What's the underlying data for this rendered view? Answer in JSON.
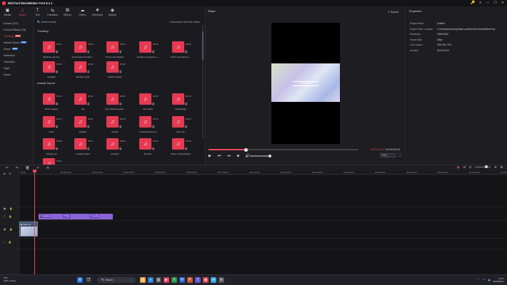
{
  "window": {
    "title": "MiniTool MovieMaker Free 8.1.1",
    "controls": [
      "🔑",
      "≡",
      "—",
      "☐",
      "✕"
    ]
  },
  "toolbar": [
    {
      "label": "Media",
      "icon": "▣"
    },
    {
      "label": "Audio",
      "icon": "♫"
    },
    {
      "label": "Text",
      "icon": "T"
    },
    {
      "label": "Transition",
      "icon": "⇆"
    },
    {
      "label": "Effects",
      "icon": "✪"
    },
    {
      "label": "Filters",
      "icon": "☁"
    },
    {
      "label": "Elements",
      "icon": "❖"
    },
    {
      "label": "Motion",
      "icon": "◉"
    }
  ],
  "sidebar": {
    "music": "▸ Music (101)",
    "sound": "▾ Sound Effects (78)",
    "items": [
      {
        "label": "Trending",
        "badge": "NEW"
      },
      {
        "label": "Animal Sound",
        "badge": "NEW"
      },
      {
        "label": "Game",
        "badge": "NEW"
      },
      {
        "label": "Ambience",
        "badge": ""
      },
      {
        "label": "Transition",
        "badge": ""
      },
      {
        "label": "Fight",
        "badge": ""
      },
      {
        "label": "Horror",
        "badge": ""
      }
    ]
  },
  "media": {
    "search": "🔍 Search audio",
    "download": "↓ Download YouTube Video",
    "sections": [
      {
        "title": "Trending",
        "tiles": [
          {
            "name": "Machine gun fire",
            "dur": "00:01"
          },
          {
            "name": "Cool impact trends A...",
            "dur": "00:05"
          },
          {
            "name": "Horror atmosphere",
            "dur": "00:06"
          },
          {
            "name": "Arcade retro game o...",
            "dur": "00:03"
          },
          {
            "name": "Clock countdown ti...",
            "dur": "00:05"
          },
          {
            "name": "Gunfight",
            "dur": "00:03"
          },
          {
            "name": "Monster howl",
            "dur": "00:03"
          },
          {
            "name": "Sinister Steam",
            "dur": "00:02"
          }
        ]
      },
      {
        "title": "Animal Sound",
        "tiles": [
          {
            "name": "Birds singing",
            "dur": "00:12"
          },
          {
            "name": "Cat",
            "dur": "00:01"
          },
          {
            "name": "Cat chattering and...",
            "dur": "00:05"
          },
          {
            "name": "Cat meow",
            "dur": "00:01"
          },
          {
            "name": "Chatty pigs",
            "dur": "00:10"
          },
          {
            "name": "Crow",
            "dur": "00:15"
          },
          {
            "name": "Dolphin",
            "dur": "00:01"
          },
          {
            "name": "Gerbils",
            "dur": "00:05"
          },
          {
            "name": "Growling bear hit",
            "dur": "00:01"
          },
          {
            "name": "Hen rise",
            "dur": "00:04"
          },
          {
            "name": "Hungry cat",
            "dur": "00:08"
          },
          {
            "name": "Leopard attack",
            "dur": "00:01"
          },
          {
            "name": "Penguin",
            "dur": "00:02"
          },
          {
            "name": "Rooster",
            "dur": "00:02"
          },
          {
            "name": "Sheer wolf growling",
            "dur": "00:05"
          },
          {
            "name": "",
            "dur": "00:03"
          }
        ]
      }
    ]
  },
  "player": {
    "title": "Player",
    "export": "⇪ Export",
    "caption": "I feel fine",
    "progress": 0.25,
    "timecode_current": "00:00:03:13",
    "timecode_total": "/ 00:00:15:10",
    "volume": 1.0,
    "ratio": "9:16",
    "controls": [
      "▶",
      "⏮",
      "⏭",
      "■",
      "🔊"
    ]
  },
  "properties": {
    "title": "Properties",
    "rows": [
      {
        "k": "Project Name",
        "v": "Untitled"
      },
      {
        "k": "Project Path / Location",
        "v": "C:\\Users\\admin\\AppData\\Local\\MiniTool MovieMaker\\Proj..."
      },
      {
        "k": "Resolution",
        "v": "1080x1920"
      },
      {
        "k": "Frame Rate",
        "v": "25fps"
      },
      {
        "k": "Color Space",
        "v": "SDR-Rec.709"
      },
      {
        "k": "Duration",
        "v": "00:00:15:10"
      }
    ]
  },
  "timeline": {
    "tools": [
      "↶",
      "↷",
      "🗑",
      "✂",
      "⟲"
    ],
    "ruler": [
      "00:00",
      "00:00:10:00",
      "00:00:20:00",
      "00:00:30:00",
      "00:00:40:00",
      "00:00:50:00",
      "00:01:00:00",
      "00:01:10:00",
      "00:01:20:00",
      "00:01:30:00",
      "00:01:40:00",
      "00:01:50:00",
      "00:02:00:00",
      "00:02:10:00",
      "00:02:20:00",
      "00:02:30:00"
    ],
    "text_clips": [
      "T Captions",
      "T Title",
      "T Credits"
    ],
    "video_clip": "▶ Video 01"
  },
  "taskbar": {
    "weather_temp": "18°C",
    "weather_desc": "Partly cloudy",
    "search": "🔍 Search",
    "time": "14:43",
    "date": "2023/08/14"
  }
}
